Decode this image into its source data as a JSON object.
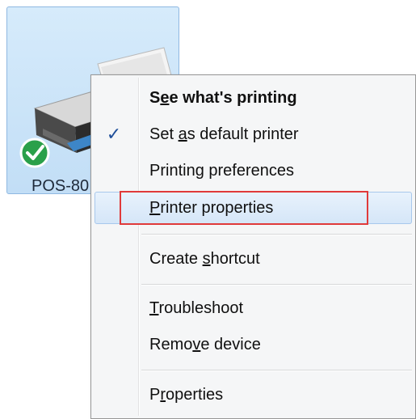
{
  "device": {
    "label": "POS-80",
    "icon": "printer-icon",
    "status_icon": "default-check-icon",
    "status_color": "#2aa04a"
  },
  "context_menu": {
    "items": [
      {
        "id": "see-whats-printing",
        "pre": "S",
        "key": "e",
        "post": "e what's printing",
        "bold": true,
        "checked": false
      },
      {
        "id": "set-default-printer",
        "pre": "Set ",
        "key": "a",
        "post": "s default printer",
        "bold": false,
        "checked": true
      },
      {
        "id": "printing-preferences",
        "pre": "Printin",
        "key": "g",
        "post": " preferences",
        "bold": false,
        "checked": false
      },
      {
        "id": "printer-properties",
        "pre": "",
        "key": "P",
        "post": "rinter properties",
        "bold": false,
        "checked": false,
        "hover": true
      },
      {
        "id": "create-shortcut",
        "pre": "Create ",
        "key": "s",
        "post": "hortcut",
        "bold": false,
        "checked": false
      },
      {
        "id": "troubleshoot",
        "pre": "",
        "key": "T",
        "post": "roubleshoot",
        "bold": false,
        "checked": false
      },
      {
        "id": "remove-device",
        "pre": "Remo",
        "key": "v",
        "post": "e device",
        "bold": false,
        "checked": false
      },
      {
        "id": "properties",
        "pre": "P",
        "key": "r",
        "post": "operties",
        "bold": false,
        "checked": false
      }
    ],
    "check_glyph": "✓",
    "check_color": "#1f4f9a",
    "highlight_color": "#e03a3a"
  }
}
